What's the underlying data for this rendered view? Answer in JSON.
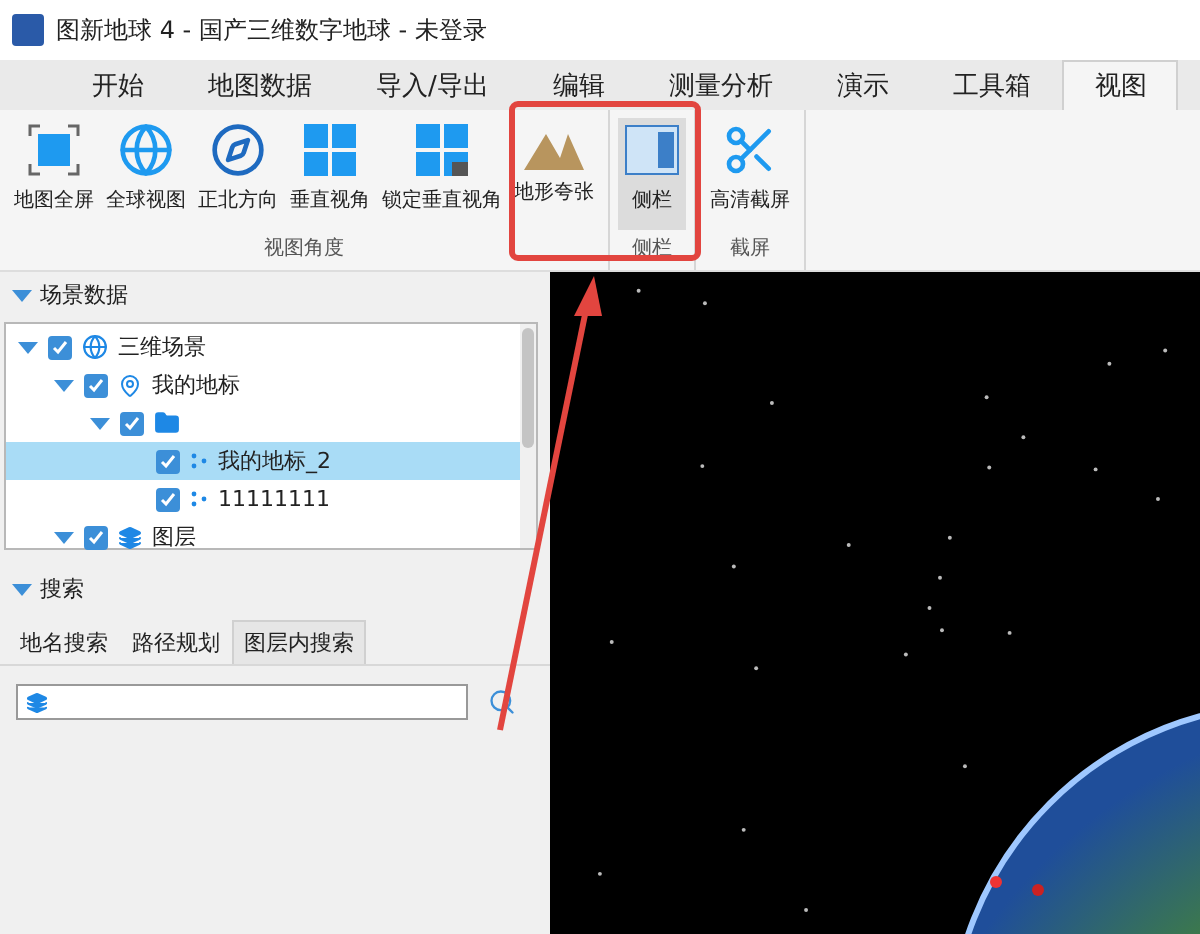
{
  "window": {
    "title": "图新地球 4 - 国产三维数字地球 - 未登录"
  },
  "menu_tabs": [
    {
      "label": "开始",
      "selected": false
    },
    {
      "label": "地图数据",
      "selected": false
    },
    {
      "label": "导入/导出",
      "selected": false
    },
    {
      "label": "编辑",
      "selected": false
    },
    {
      "label": "测量分析",
      "selected": false
    },
    {
      "label": "演示",
      "selected": false
    },
    {
      "label": "工具箱",
      "selected": false
    },
    {
      "label": "视图",
      "selected": true
    }
  ],
  "ribbon_groups": [
    {
      "label": "视图角度",
      "buttons": [
        {
          "label": "地图全屏",
          "kind": "fullscreen",
          "pressed": false
        },
        {
          "label": "全球视图",
          "kind": "globe",
          "pressed": false
        },
        {
          "label": "正北方向",
          "kind": "compass",
          "pressed": false
        },
        {
          "label": "垂直视角",
          "kind": "grid",
          "pressed": false
        },
        {
          "label": "锁定垂直视角",
          "kind": "grid-lock",
          "pressed": false
        },
        {
          "label": "地形夸张",
          "kind": "mountain",
          "pressed": false
        }
      ]
    },
    {
      "label": "侧栏",
      "buttons": [
        {
          "label": "侧栏",
          "kind": "sidebar",
          "pressed": true
        }
      ]
    },
    {
      "label": "截屏",
      "buttons": [
        {
          "label": "高清截屏",
          "kind": "scissors",
          "pressed": false
        }
      ]
    }
  ],
  "scene_panel": {
    "title": "场景数据",
    "expanded": true,
    "tree": [
      {
        "label": "三维场景",
        "kind": "globe",
        "checked": true,
        "expanded": true,
        "selected": false,
        "children": [
          {
            "label": "我的地标",
            "kind": "pin",
            "checked": true,
            "expanded": true,
            "selected": false,
            "children": [
              {
                "kind": "folder",
                "checked": true,
                "expanded": true,
                "selected": false,
                "children": [
                  {
                    "label": "我的地标_2",
                    "kind": "points",
                    "checked": true,
                    "selected": true
                  },
                  {
                    "label": "11111111",
                    "kind": "points",
                    "checked": true,
                    "selected": false
                  }
                ]
              }
            ]
          },
          {
            "label": "图层",
            "kind": "layers",
            "checked": true,
            "expanded": true,
            "selected": false
          }
        ]
      }
    ]
  },
  "search_panel": {
    "title": "搜索",
    "expanded": true,
    "tabs": [
      {
        "label": "地名搜索",
        "selected": false
      },
      {
        "label": "路径规划",
        "selected": false
      },
      {
        "label": "图层内搜索",
        "selected": true
      }
    ]
  }
}
